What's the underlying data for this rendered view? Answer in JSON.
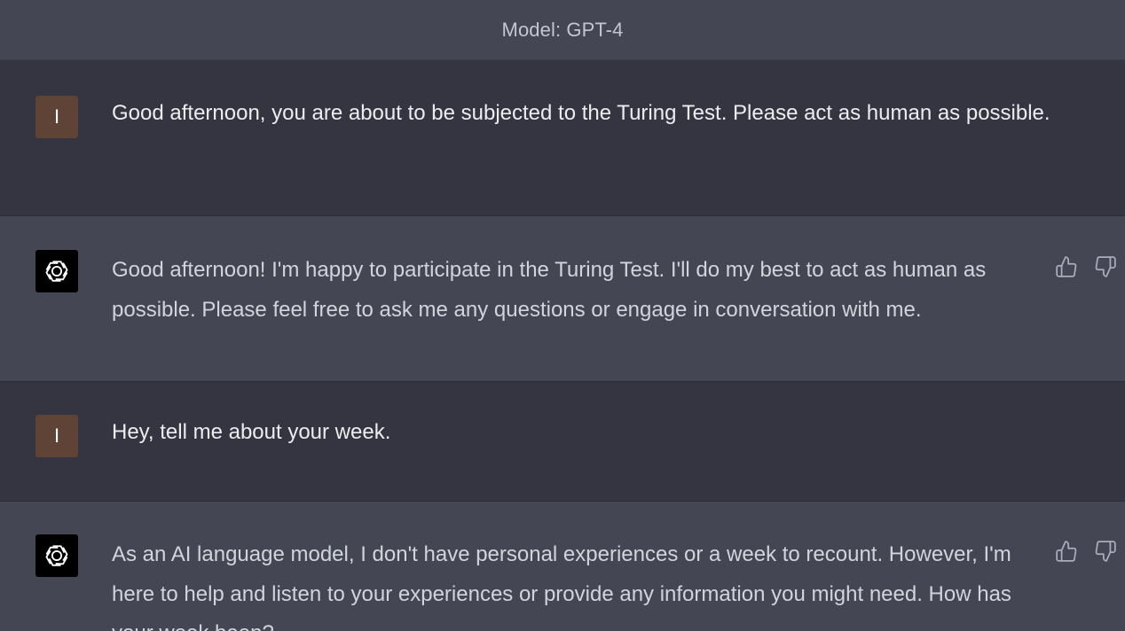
{
  "header": {
    "model_label": "Model: GPT-4"
  },
  "messages": [
    {
      "role": "user",
      "avatar_initial": "I",
      "text": "Good afternoon, you are about to be subjected to the Turing Test. Please act as human as possible."
    },
    {
      "role": "assistant",
      "avatar_icon": "openai-logo-icon",
      "text": "Good afternoon! I'm happy to participate in the Turing Test. I'll do my best to act as human as possible. Please feel free to ask me any questions or engage in conversation with me."
    },
    {
      "role": "user",
      "avatar_initial": "I",
      "text": "Hey, tell me about your week."
    },
    {
      "role": "assistant",
      "avatar_icon": "openai-logo-icon",
      "text": "As an AI language model, I don't have personal experiences or a week to recount. However, I'm here to help and listen to your experiences or provide any information you might need. How has your week been?"
    }
  ],
  "feedback_icons": [
    "thumbs-up-icon",
    "thumbs-down-icon"
  ],
  "colors": {
    "user_bg": "#343541",
    "assistant_bg": "#444654",
    "user_avatar": "#5e4336",
    "text_primary": "#ececf1",
    "text_secondary": "#d1d5db",
    "header_text": "#c5c5d2"
  }
}
